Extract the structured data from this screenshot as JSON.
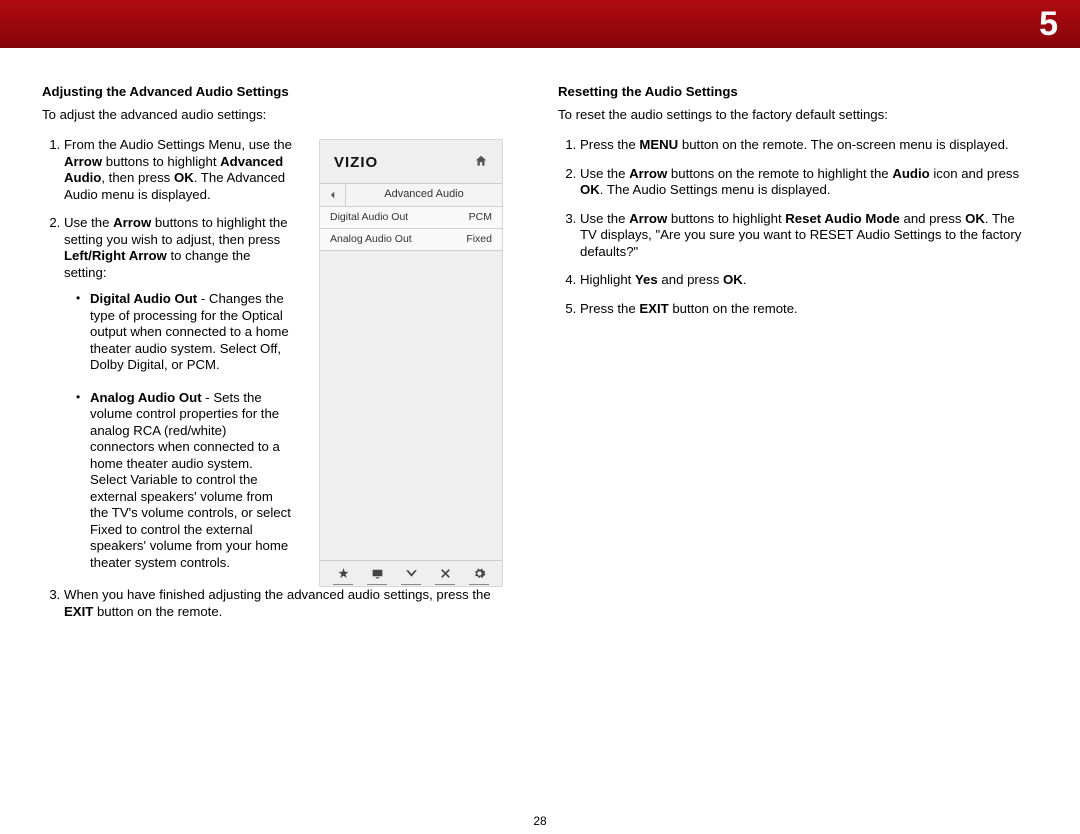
{
  "chapter_number": "5",
  "page_number": "28",
  "left": {
    "title": "Adjusting the Advanced Audio Settings",
    "intro": "To adjust the advanced audio settings:",
    "step1_a": "From the Audio Settings Menu, use the ",
    "step1_b_bold": "Arrow",
    "step1_c": " buttons to highlight ",
    "step1_d_bold": "Advanced Audio",
    "step1_e": ", then press ",
    "step1_f_bold": "OK",
    "step1_g": ". The Advanced Audio menu is displayed.",
    "step2_a": "Use the ",
    "step2_b_bold": "Arrow",
    "step2_c": " buttons to highlight the setting you wish to adjust, then press ",
    "step2_d_bold": "Left/Right Arrow",
    "step2_e": " to change the setting:",
    "bullet1_bold": "Digital Audio Out",
    "bullet1_text": " - Changes the type of processing for the Optical output when connected to a home theater audio system. Select Off, Dolby Digital, or PCM.",
    "bullet2_bold": "Analog Audio Out",
    "bullet2_text": " - Sets the volume control properties for the analog RCA (red/white) connectors when connected to a home theater audio system. Select Variable to control the external speakers' volume from the TV's volume controls, or select Fixed to control the external speakers' volume from your home theater system controls.",
    "step3_a": "When you have finished adjusting the advanced audio settings, press the ",
    "step3_b_bold": "EXIT",
    "step3_c": " button on the remote."
  },
  "right": {
    "title": "Resetting the Audio Settings",
    "intro": "To reset the audio settings to the factory default settings:",
    "step1_a": "Press the ",
    "step1_b_bold": "MENU",
    "step1_c": " button on the remote. The on-screen menu is displayed.",
    "step2_a": "Use the ",
    "step2_b_bold": "Arrow",
    "step2_c": " buttons on the remote to highlight the ",
    "step2_d_bold": "Audio",
    "step2_e": " icon and press ",
    "step2_f_bold": "OK",
    "step2_g": ". The Audio Settings menu is displayed.",
    "step3_a": "Use the ",
    "step3_b_bold": "Arrow",
    "step3_c": " buttons to highlight ",
    "step3_d_bold": "Reset Audio Mode",
    "step3_e": " and press ",
    "step3_f_bold": "OK",
    "step3_g": ". The TV displays, \"Are you sure you want to RESET Audio Settings to the factory defaults?\"",
    "step4_a": "Highlight ",
    "step4_b_bold": "Yes",
    "step4_c": " and press ",
    "step4_d_bold": "OK",
    "step4_e": ".",
    "step5_a": "Press the ",
    "step5_b_bold": "EXIT",
    "step5_c": " button on the remote."
  },
  "panel": {
    "logo": "VIZIO",
    "menu_title": "Advanced Audio",
    "row1_label": "Digital Audio Out",
    "row1_value": "PCM",
    "row2_label": "Analog Audio Out",
    "row2_value": "Fixed"
  }
}
